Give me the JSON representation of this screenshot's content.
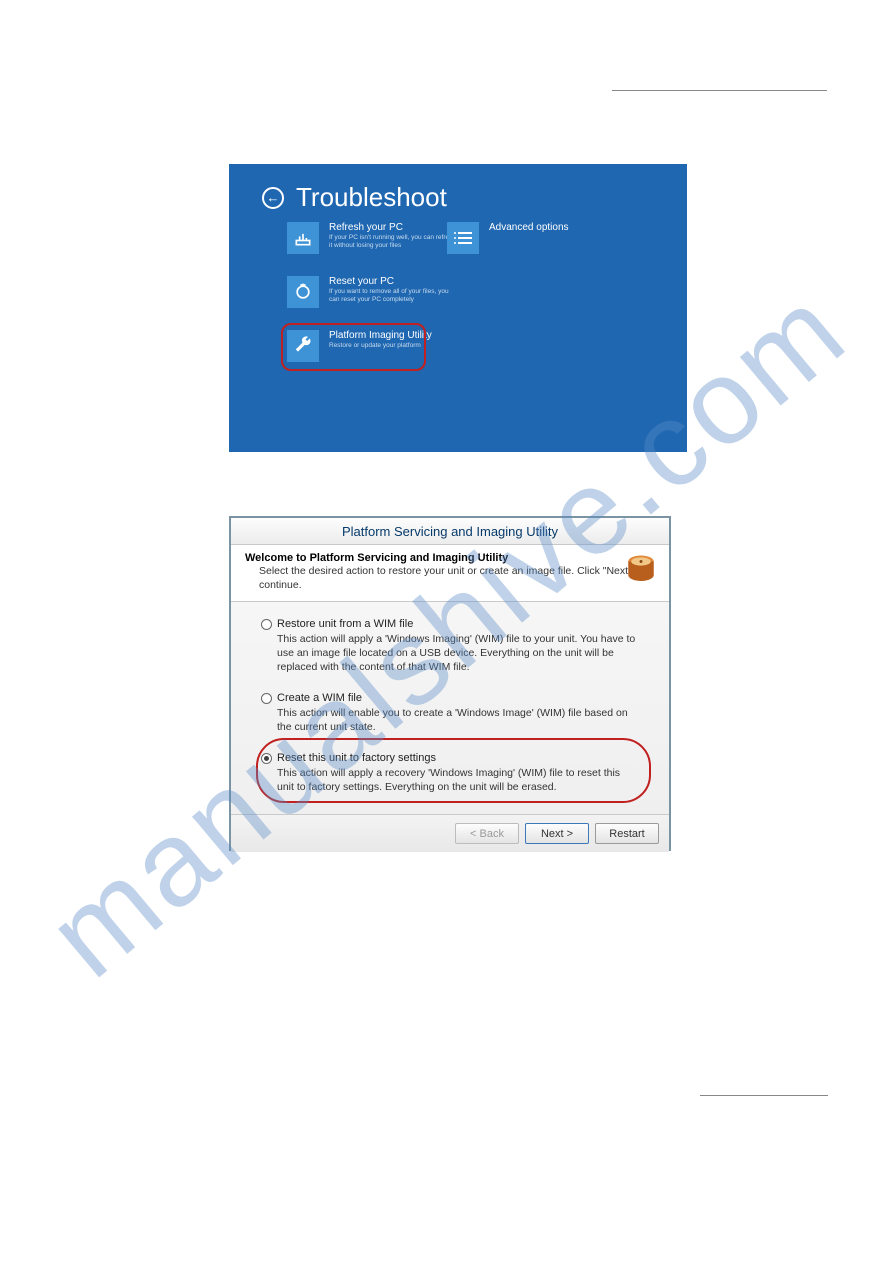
{
  "watermark": "manualshive.com",
  "troubleshoot": {
    "title": "Troubleshoot",
    "tiles": [
      {
        "title": "Refresh your PC",
        "sub": "If your PC isn't running well, you can refresh it without losing your files"
      },
      {
        "title": "Reset your PC",
        "sub": "If you want to remove all of your files, you can reset your PC completely"
      },
      {
        "title": "Platform Imaging Utility",
        "sub": "Restore or update your platform"
      }
    ],
    "advanced": "Advanced options"
  },
  "wizard": {
    "window_title": "Platform Servicing and Imaging Utility",
    "header_title": "Welcome to Platform Servicing and Imaging Utility",
    "header_sub": "Select the desired action to restore your unit or create an image file. Click \"Next\" to continue.",
    "options": [
      {
        "label": "Restore unit from a WIM file",
        "desc": "This action will apply a 'Windows Imaging' (WIM) file to your unit. You have to use an image file located on a USB device. Everything on the unit will be replaced with the content of that WIM file."
      },
      {
        "label": "Create a WIM file",
        "desc": "This action will enable you to create a 'Windows Image' (WIM) file based on the current unit state."
      },
      {
        "label": "Reset this unit to factory settings",
        "desc": "This action will apply a recovery 'Windows Imaging' (WIM) file to reset this unit to factory settings. Everything on the unit will be erased."
      }
    ],
    "buttons": {
      "back": "< Back",
      "next": "Next >",
      "restart": "Restart"
    }
  }
}
